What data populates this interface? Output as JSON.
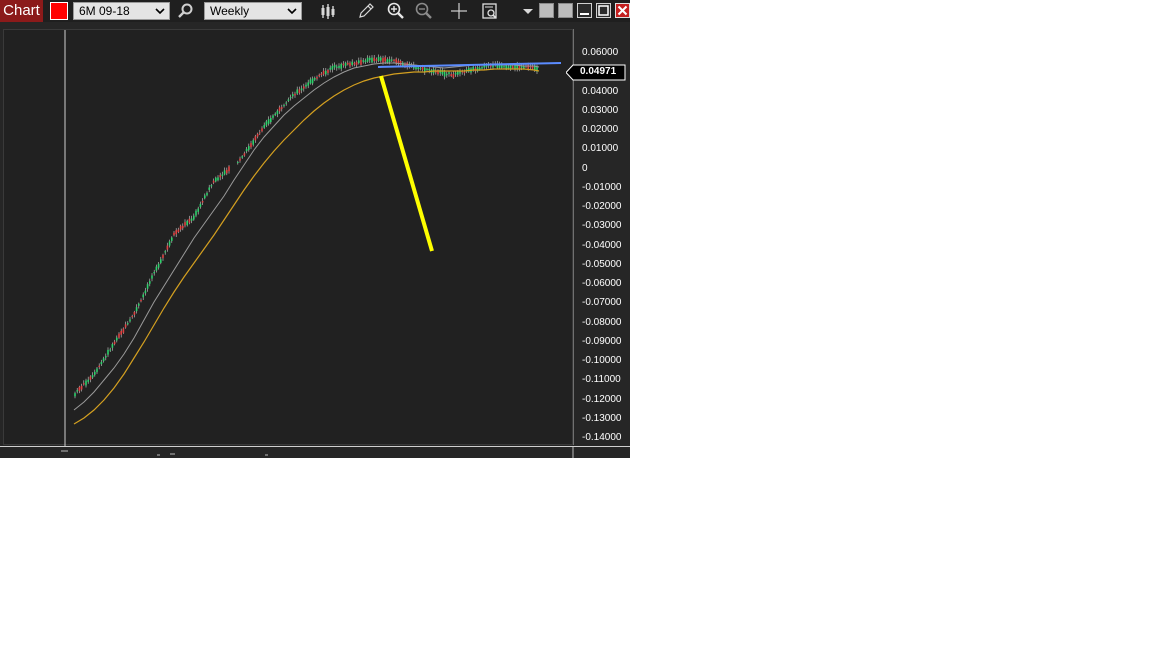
{
  "window": {
    "title": "Chart"
  },
  "toolbar": {
    "instrument": "6M 09-18",
    "period": "Weekly",
    "icons": [
      "color-swatch",
      "search-icon",
      "bar-style-icon",
      "pencil-icon",
      "zoom-in-icon",
      "zoom-out-icon",
      "crosshair-icon",
      "properties-icon",
      "dropdown-icon",
      "tile-icon",
      "tile-icon-2",
      "minimize-icon",
      "maximize-icon",
      "close-icon"
    ]
  },
  "price_axis": {
    "labels": [
      "0.06000",
      "0.05000",
      "0.04000",
      "0.03000",
      "0.02000",
      "0.01000",
      "0",
      "-0.01000",
      "-0.02000",
      "-0.03000",
      "-0.04000",
      "-0.05000",
      "-0.06000",
      "-0.07000",
      "-0.08000",
      "-0.09000",
      "-0.10000",
      "-0.11000",
      "-0.12000",
      "-0.13000",
      "-0.14000"
    ],
    "last_price": "0.04971"
  },
  "colors": {
    "accent_title": "#8b1a1a",
    "ma_fast": "#9a9a9a",
    "ma_slow": "#d4a020",
    "trendline": "#5b8cff",
    "annotation": "#ffff00",
    "candle_up": "#2bd16a",
    "candle_down": "#e04040"
  }
}
